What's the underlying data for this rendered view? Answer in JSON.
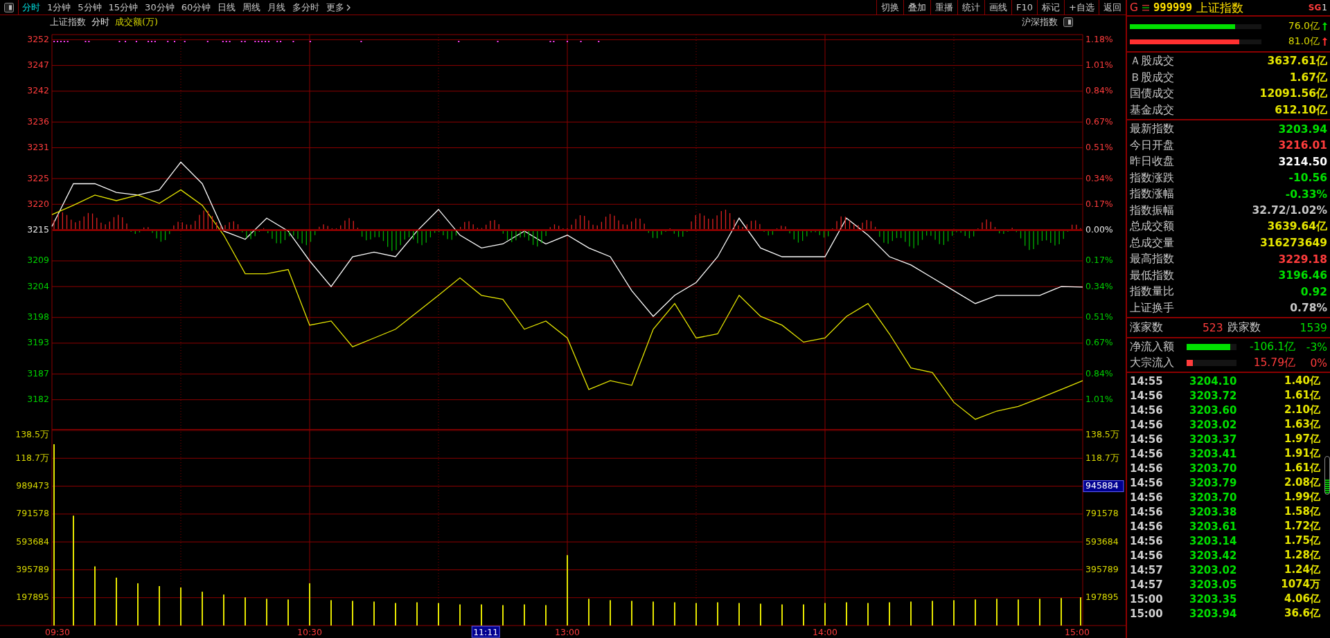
{
  "toolbar": {
    "period_tabs": [
      {
        "label": "分时",
        "selected": true
      },
      {
        "label": "1分钟",
        "selected": false
      },
      {
        "label": "5分钟",
        "selected": false
      },
      {
        "label": "15分钟",
        "selected": false
      },
      {
        "label": "30分钟",
        "selected": false
      },
      {
        "label": "60分钟",
        "selected": false
      },
      {
        "label": "日线",
        "selected": false
      },
      {
        "label": "周线",
        "selected": false
      },
      {
        "label": "月线",
        "selected": false
      },
      {
        "label": "多分时",
        "selected": false
      }
    ],
    "more_button": {
      "label": "更多"
    },
    "tool_buttons": [
      "切换",
      "叠加",
      "重播",
      "统计",
      "画线",
      "F10",
      "标记",
      "+自选",
      "返回"
    ]
  },
  "chart": {
    "header": {
      "title": "上证指数",
      "period": "分时",
      "indicator": "成交额(万)",
      "switch_label": "沪深指数"
    },
    "price_panel": {
      "chart_data": {
        "type": "line",
        "grid": true,
        "categories": [
          null,
          null,
          null,
          null,
          null,
          null,
          null,
          null,
          null,
          null,
          null,
          null,
          null,
          null,
          null,
          null,
          null,
          null,
          null,
          null,
          null,
          null,
          null,
          null,
          null,
          null,
          null,
          null,
          null,
          null,
          null,
          null,
          null,
          null,
          null,
          null,
          null,
          null,
          null,
          null,
          null,
          null,
          null,
          null,
          null,
          null,
          null,
          null,
          null
        ],
        "series": [
          {
            "color": "#ffffff",
            "values": [
              3215.7,
              3224.0,
              3224.0,
              3222.3,
              3221.8,
              3222.8,
              3228.2,
              3224.0,
              3214.8,
              3213.2,
              3217.3,
              3214.8,
              3209.0,
              3204.0,
              3209.8,
              3210.7,
              3209.8,
              3214.8,
              3219.0,
              3214.0,
              3211.5,
              3212.3,
              3214.8,
              3212.3,
              3214.0,
              3211.5,
              3209.8,
              3203.2,
              3198.2,
              3202.3,
              3204.8,
              3209.8,
              3217.3,
              3211.5,
              3209.8,
              3209.8,
              3209.8,
              3217.3,
              3214.0,
              3209.8,
              3208.2,
              3205.7,
              3203.2,
              3200.7,
              3202.3,
              3202.3,
              3202.3,
              3204.0,
              3203.9
            ]
          },
          {
            "color": "#e6e600",
            "values": [
              3218.0,
              3219.8,
              3221.8,
              3220.7,
              3221.8,
              3220.2,
              3222.8,
              3219.8,
              3214.0,
              3206.5,
              3206.5,
              3207.3,
              3196.5,
              3197.3,
              3192.3,
              3194.0,
              3195.7,
              3199.0,
              3202.3,
              3205.7,
              3202.3,
              3201.5,
              3195.7,
              3197.3,
              3194.0,
              3184.0,
              3185.7,
              3184.8,
              3195.7,
              3200.7,
              3194.0,
              3194.8,
              3202.3,
              3198.2,
              3196.5,
              3193.2,
              3194.0,
              3198.2,
              3200.7,
              3194.8,
              3188.2,
              3187.3,
              3181.5,
              3178.2,
              3179.8,
              3180.7,
              3182.3,
              3184.0,
              3185.7
            ]
          }
        ],
        "ylim": [
          3176.3,
          3253.0
        ],
        "yticks": [
          3252,
          3247,
          3242,
          3236,
          3231,
          3225,
          3220,
          3215,
          3209,
          3204,
          3198,
          3193,
          3187,
          3182
        ]
      },
      "percent_axis": [
        {
          "text": "1.18%",
          "kind": "up"
        },
        {
          "text": "1.01%",
          "kind": "up"
        },
        {
          "text": "0.84%",
          "kind": "up"
        },
        {
          "text": "0.67%",
          "kind": "up"
        },
        {
          "text": "0.51%",
          "kind": "up"
        },
        {
          "text": "0.34%",
          "kind": "up"
        },
        {
          "text": "0.17%",
          "kind": "up"
        },
        {
          "text": "0.00%",
          "kind": "flat"
        },
        {
          "text": "0.17%",
          "kind": "down"
        },
        {
          "text": "0.34%",
          "kind": "down"
        },
        {
          "text": "0.51%",
          "kind": "down"
        },
        {
          "text": "0.67%",
          "kind": "down"
        },
        {
          "text": "0.84%",
          "kind": "down"
        },
        {
          "text": "1.01%",
          "kind": "down"
        }
      ]
    },
    "volume_panel": {
      "chart_data": {
        "type": "bar",
        "grid": true,
        "categories": [
          "09:30",
          null,
          null,
          null,
          null,
          null,
          null,
          null,
          null,
          null,
          null,
          null,
          "10:30",
          null,
          null,
          null,
          null,
          null,
          null,
          null,
          null,
          null,
          null,
          null,
          "13:00",
          null,
          null,
          null,
          null,
          null,
          null,
          null,
          null,
          null,
          null,
          null,
          "14:00",
          null,
          null,
          null,
          null,
          null,
          null,
          null,
          null,
          null,
          null,
          null,
          "15:00"
        ],
        "series": [
          {
            "color": "#e6e600",
            "values": [
              1287000,
              780000,
              420000,
              340000,
              300000,
              280000,
              270000,
              240000,
              220000,
              200000,
              190000,
              185000,
              300000,
              180000,
              175000,
              170000,
              160000,
              165000,
              160000,
              150000,
              150000,
              145000,
              150000,
              145000,
              500000,
              190000,
              180000,
              175000,
              170000,
              165000,
              160000,
              165000,
              160000,
              155000,
              150000,
              150000,
              160000,
              165000,
              160000,
              165000,
              170000,
              175000,
              180000,
              185000,
              190000,
              185000,
              190000,
              195000,
              200000
            ]
          }
        ],
        "ylim": [
          0,
          1395000
        ],
        "yticks": [
          989473,
          791578,
          593684,
          395789,
          197895
        ]
      },
      "left_axis_extra": [
        "138.5万",
        "118.7万"
      ],
      "right_axis": [
        {
          "text": "138.5万",
          "kind": "normal"
        },
        {
          "text": "118.7万",
          "kind": "normal"
        },
        {
          "text": "945884",
          "kind": "cursor"
        },
        {
          "text": "791578",
          "kind": "normal"
        },
        {
          "text": "593684",
          "kind": "normal"
        },
        {
          "text": "395789",
          "kind": "normal"
        },
        {
          "text": "197895",
          "kind": "normal"
        }
      ],
      "cursor_time": "11:11"
    }
  },
  "quote_panel": {
    "header": {
      "market": "G",
      "code": "999999",
      "name": "上证指数",
      "badge": "SG",
      "badge_index": "1"
    },
    "flow_bars": [
      {
        "kind": "buy",
        "value": "76.0亿",
        "level": 0.8
      },
      {
        "kind": "sell",
        "value": "81.0亿",
        "level": 0.83
      }
    ],
    "turnover": [
      {
        "label": "Ａ股成交",
        "value": "3637.61亿"
      },
      {
        "label": "Ｂ股成交",
        "value": "1.67亿"
      },
      {
        "label": "国债成交",
        "value": "12091.56亿"
      },
      {
        "label": "基金成交",
        "value": "612.10亿"
      }
    ],
    "stats": [
      {
        "label": "最新指数",
        "value": "3203.94",
        "color": "#00e000"
      },
      {
        "label": "今日开盘",
        "value": "3216.01",
        "color": "#ff3c3c"
      },
      {
        "label": "昨日收盘",
        "value": "3214.50",
        "color": "#ffffff"
      },
      {
        "label": "指数涨跌",
        "value": "-10.56",
        "color": "#00e000"
      },
      {
        "label": "指数涨幅",
        "value": "-0.33%",
        "color": "#00e000"
      },
      {
        "label": "指数振幅",
        "value": "32.72/1.02%",
        "color": "#c8c8c8"
      },
      {
        "label": "总成交额",
        "value": "3639.64亿",
        "color": "#e6e600"
      },
      {
        "label": "总成交量",
        "value": "316273649",
        "color": "#e6e600"
      },
      {
        "label": "最高指数",
        "value": "3229.18",
        "color": "#ff3c3c"
      },
      {
        "label": "最低指数",
        "value": "3196.46",
        "color": "#00e000"
      },
      {
        "label": "指数量比",
        "value": "0.92",
        "color": "#00e000"
      },
      {
        "label": "上证换手",
        "value": "0.78%",
        "color": "#c8c8c8"
      }
    ],
    "breadth": {
      "up_label": "涨家数",
      "up": "523",
      "down_label": "跌家数",
      "down": "1539"
    },
    "flows": [
      {
        "label": "净流入额",
        "value": "-106.1亿",
        "pct": "-3%",
        "level": 0.88,
        "color": "#00e000"
      },
      {
        "label": "大宗流入",
        "value": "15.79亿",
        "pct": "0%",
        "level": 0.12,
        "color": "#ff3c3c"
      }
    ],
    "ticks": [
      {
        "time": "14:55",
        "price": "3204.10",
        "amount": "1.40亿"
      },
      {
        "time": "14:56",
        "price": "3203.72",
        "amount": "1.61亿"
      },
      {
        "time": "14:56",
        "price": "3203.60",
        "amount": "2.10亿"
      },
      {
        "time": "14:56",
        "price": "3203.02",
        "amount": "1.63亿"
      },
      {
        "time": "14:56",
        "price": "3203.37",
        "amount": "1.97亿"
      },
      {
        "time": "14:56",
        "price": "3203.41",
        "amount": "1.91亿"
      },
      {
        "time": "14:56",
        "price": "3203.70",
        "amount": "1.61亿"
      },
      {
        "time": "14:56",
        "price": "3203.79",
        "amount": "2.08亿"
      },
      {
        "time": "14:56",
        "price": "3203.70",
        "amount": "1.99亿"
      },
      {
        "time": "14:56",
        "price": "3203.38",
        "amount": "1.58亿"
      },
      {
        "time": "14:56",
        "price": "3203.61",
        "amount": "1.72亿"
      },
      {
        "time": "14:56",
        "price": "3203.14",
        "amount": "1.75亿"
      },
      {
        "time": "14:56",
        "price": "3203.42",
        "amount": "1.28亿"
      },
      {
        "time": "14:57",
        "price": "3203.02",
        "amount": "1.24亿"
      },
      {
        "time": "14:57",
        "price": "3203.05",
        "amount": "1074万"
      },
      {
        "time": "15:00",
        "price": "3203.35",
        "amount": "4.06亿"
      },
      {
        "time": "15:00",
        "price": "3203.94",
        "amount": "36.6亿"
      }
    ]
  }
}
